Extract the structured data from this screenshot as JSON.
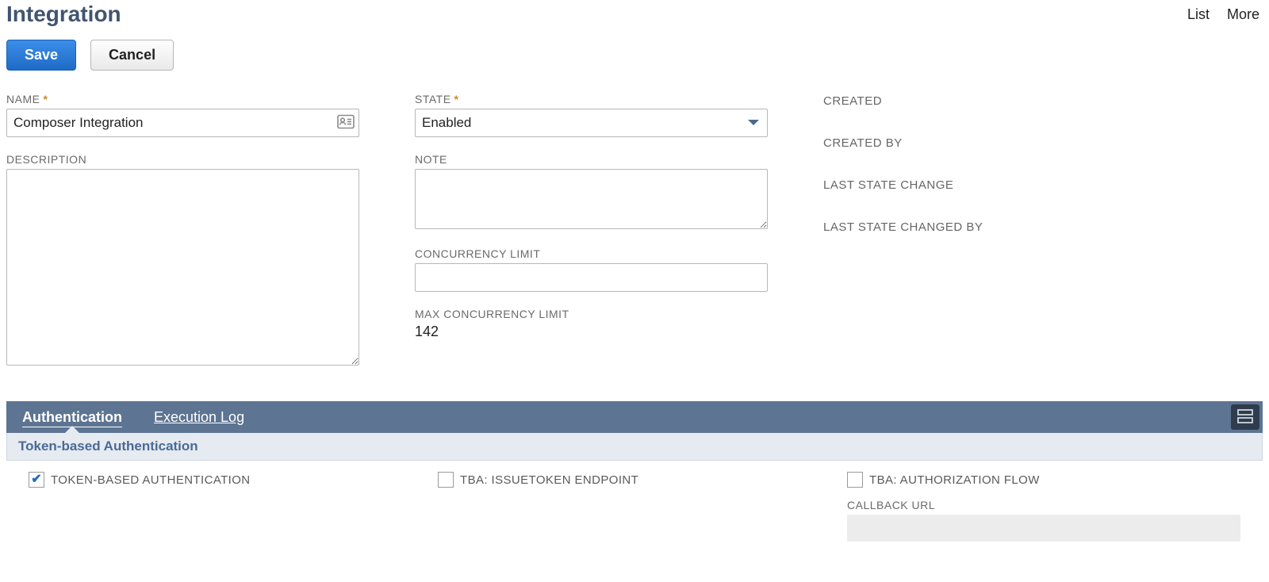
{
  "header": {
    "title": "Integration",
    "links": {
      "list": "List",
      "more": "More"
    }
  },
  "actions": {
    "save": "Save",
    "cancel": "Cancel"
  },
  "form": {
    "name": {
      "label": "NAME",
      "value": "Composer Integration"
    },
    "description": {
      "label": "DESCRIPTION",
      "value": ""
    },
    "state": {
      "label": "STATE",
      "value": "Enabled"
    },
    "note": {
      "label": "NOTE",
      "value": ""
    },
    "concurrency": {
      "label": "CONCURRENCY LIMIT",
      "value": ""
    },
    "max_concurrency": {
      "label": "MAX CONCURRENCY LIMIT",
      "value": "142"
    },
    "meta": {
      "created": "CREATED",
      "created_by": "CREATED BY",
      "last_state_change": "LAST STATE CHANGE",
      "last_state_changed_by": "LAST STATE CHANGED BY"
    }
  },
  "tabs": {
    "auth": "Authentication",
    "exec": "Execution Log"
  },
  "auth_section": {
    "heading": "Token-based Authentication",
    "tba": {
      "label": "TOKEN-BASED AUTHENTICATION",
      "checked": true
    },
    "issuetoken": {
      "label": "TBA: ISSUETOKEN ENDPOINT",
      "checked": false
    },
    "authflow": {
      "label": "TBA: AUTHORIZATION FLOW",
      "checked": false
    },
    "callback": {
      "label": "CALLBACK URL",
      "value": ""
    }
  }
}
